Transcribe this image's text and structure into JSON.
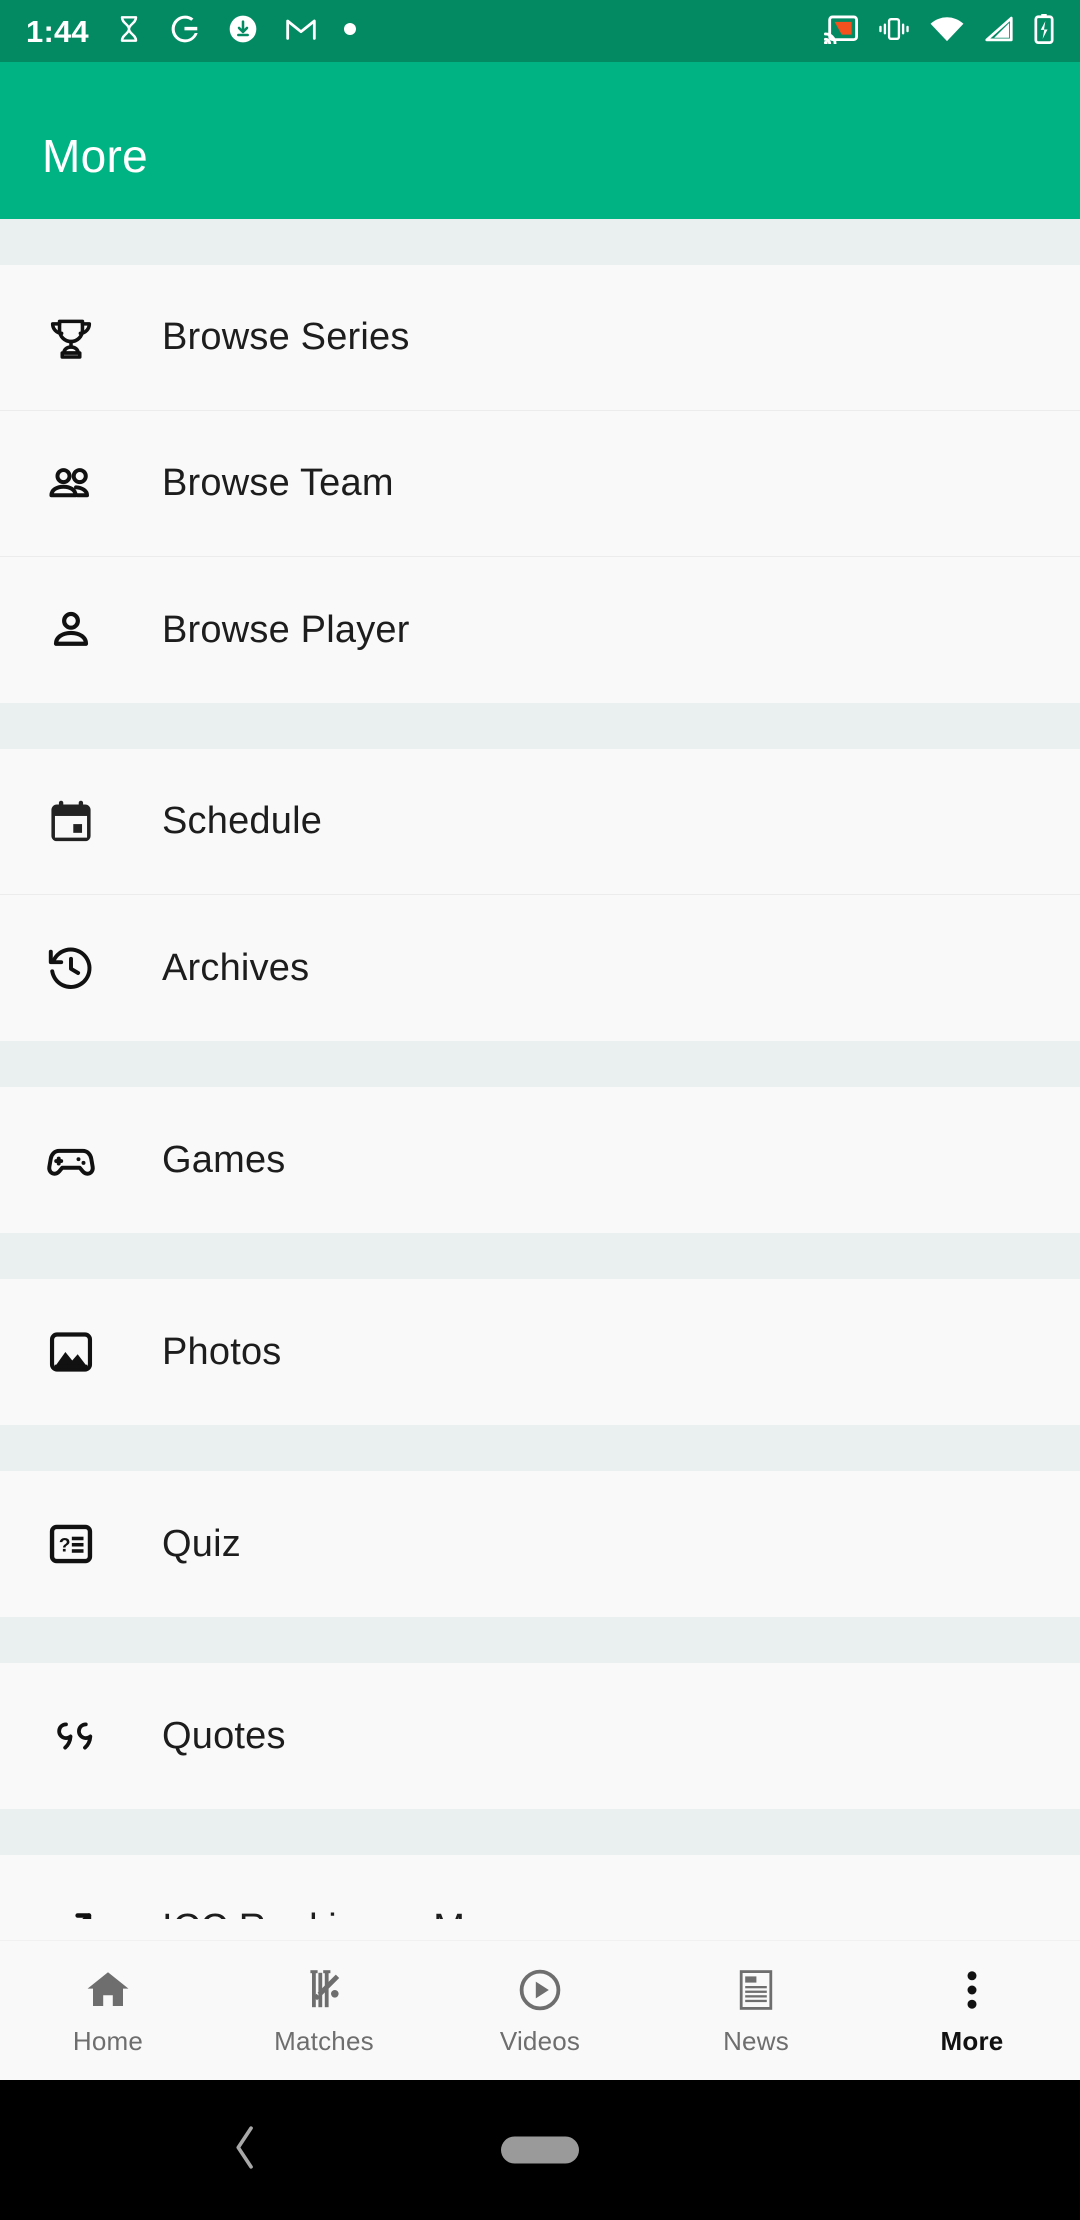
{
  "status_bar": {
    "time": "1:44",
    "left_icons": [
      "hourglass-icon",
      "google-icon",
      "download-circle-icon",
      "gmail-icon",
      "dot-icon"
    ],
    "right_icons": [
      "cast-icon",
      "vibrate-icon",
      "wifi-icon",
      "cellular-signal-icon",
      "battery-charging-icon"
    ],
    "background_color": "#038a63",
    "foreground_color": "#ffffff",
    "cast_accent_color": "#f4511e"
  },
  "app_bar": {
    "title": "More",
    "background_color": "#00b382",
    "title_color": "#ffffff"
  },
  "menu": {
    "groups": [
      {
        "items": [
          {
            "label": "Browse Series",
            "icon": "trophy-icon"
          },
          {
            "label": "Browse Team",
            "icon": "people-icon"
          },
          {
            "label": "Browse Player",
            "icon": "person-icon"
          }
        ]
      },
      {
        "items": [
          {
            "label": "Schedule",
            "icon": "calendar-icon"
          },
          {
            "label": "Archives",
            "icon": "history-icon"
          }
        ]
      },
      {
        "items": [
          {
            "label": "Games",
            "icon": "gamepad-icon"
          }
        ]
      },
      {
        "items": [
          {
            "label": "Photos",
            "icon": "image-icon"
          }
        ]
      },
      {
        "items": [
          {
            "label": "Quiz",
            "icon": "quiz-icon"
          }
        ]
      },
      {
        "items": [
          {
            "label": "Quotes",
            "icon": "quote-icon"
          }
        ]
      },
      {
        "items": [
          {
            "label": "ICC Rankings - Men",
            "icon": "trending-up-icon"
          }
        ]
      }
    ]
  },
  "bottom_nav": {
    "active": "More",
    "items": [
      {
        "label": "Home",
        "icon": "home-icon"
      },
      {
        "label": "Matches",
        "icon": "cricket-bat-icon"
      },
      {
        "label": "Videos",
        "icon": "play-circle-icon"
      },
      {
        "label": "News",
        "icon": "news-article-icon"
      },
      {
        "label": "More",
        "icon": "more-vertical-icon"
      }
    ],
    "inactive_color": "#6e6e6e",
    "active_color": "#111111"
  },
  "system_nav": {
    "background_color": "#000000",
    "back_icon": "chevron-left-icon",
    "home_indicator": "home-pill-indicator"
  },
  "colors": {
    "row_background": "#f9f9f9",
    "group_separator": "#eaeff0",
    "divider": "#ececec",
    "text": "#1d1d1d"
  }
}
